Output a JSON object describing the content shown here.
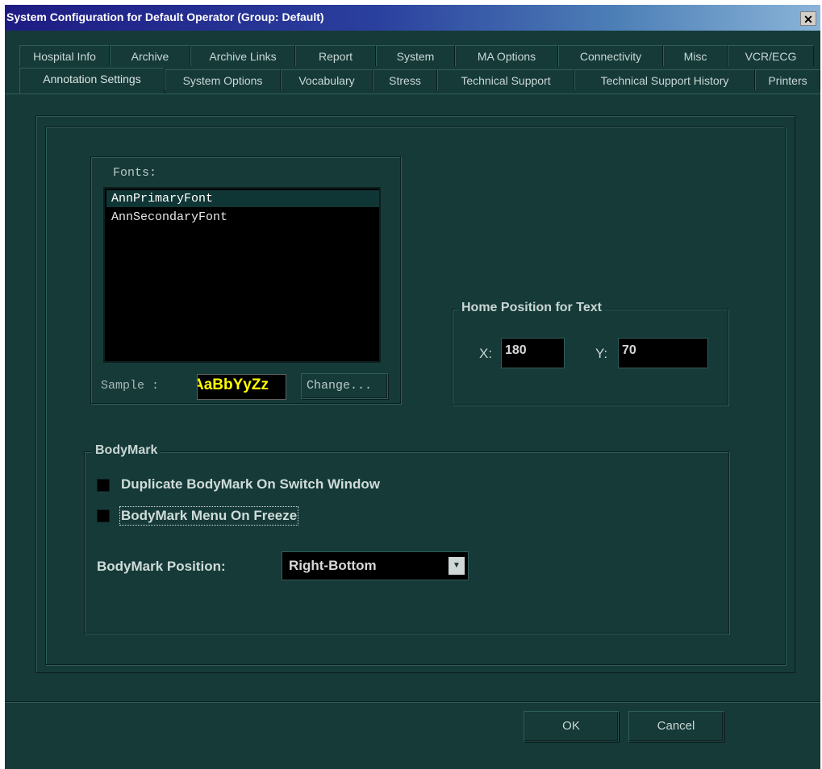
{
  "window": {
    "title": "System Configuration for Default Operator (Group: Default)",
    "close_glyph": "✕"
  },
  "tabs_row1": [
    "Hospital Info",
    "Archive",
    "Archive Links",
    "Report",
    "System",
    "MA Options",
    "Connectivity",
    "Misc",
    "VCR/ECG"
  ],
  "tabs_row2": [
    "Annotation Settings",
    "System Options",
    "Vocabulary",
    "Stress",
    "Technical Support",
    "Technical Support History",
    "Printers"
  ],
  "active_tab": "Annotation Settings",
  "fonts": {
    "label": "Fonts:",
    "items": [
      "AnnPrimaryFont",
      "AnnSecondaryFont"
    ],
    "selected": "AnnPrimaryFont",
    "sample_label": "Sample :",
    "sample_text": "AaBbYyZz",
    "change_label": "Change..."
  },
  "home_position": {
    "title": "Home Position for Text",
    "x_label": "X:",
    "x_value": "180",
    "y_label": "Y:",
    "y_value": "70"
  },
  "bodymark": {
    "title": "BodyMark",
    "duplicate_label": "Duplicate BodyMark On Switch Window",
    "duplicate_checked": false,
    "menu_freeze_label": "BodyMark Menu On Freeze",
    "menu_freeze_checked": false,
    "position_label": "BodyMark Position:",
    "position_value": "Right-Bottom"
  },
  "buttons": {
    "ok": "OK",
    "cancel": "Cancel"
  },
  "colors": {
    "background": "#163a38",
    "list_background": "#000000",
    "sample_text": "#ffff00"
  }
}
